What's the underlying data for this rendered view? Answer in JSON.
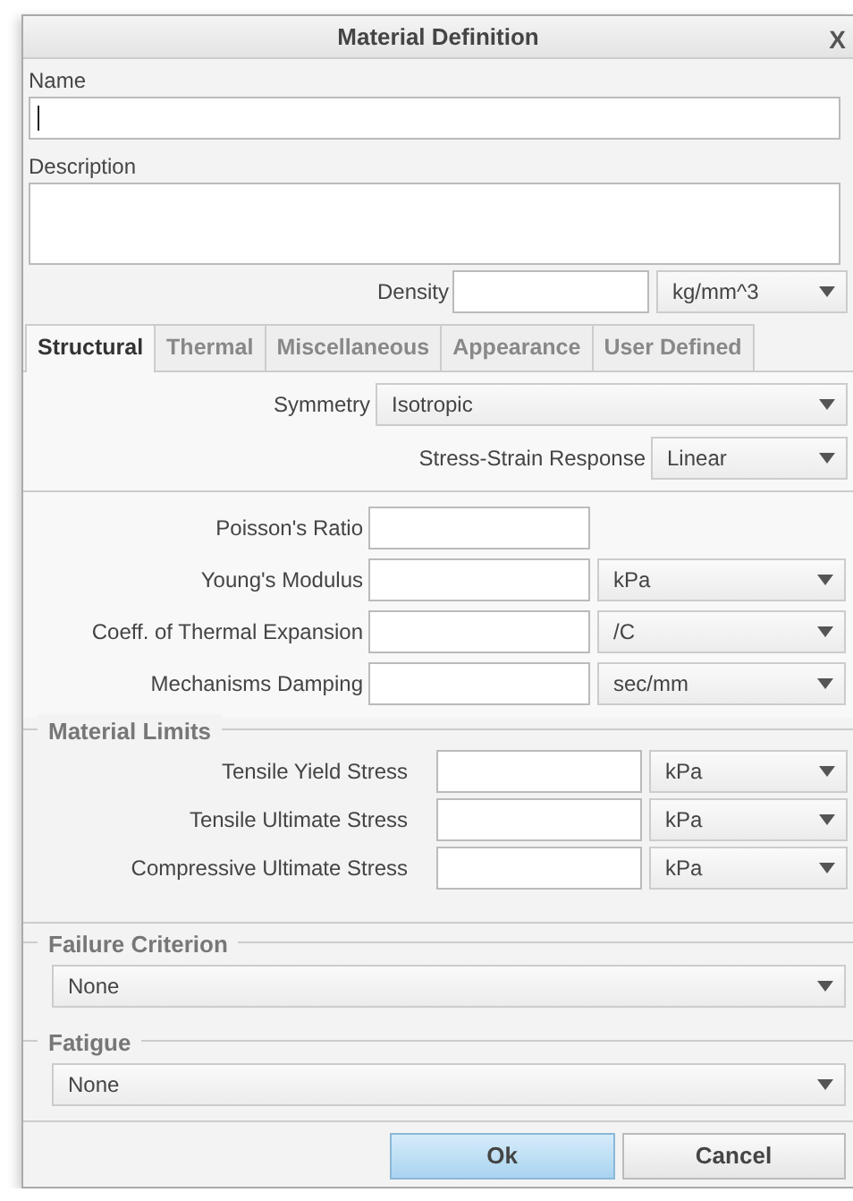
{
  "window": {
    "title": "Material Definition",
    "close": "X"
  },
  "name": {
    "label": "Name",
    "focused": true
  },
  "description": {
    "label": "Description"
  },
  "density": {
    "label": "Density",
    "unit": "kg/mm^3"
  },
  "tabs": [
    {
      "label": "Structural",
      "selected": true
    },
    {
      "label": "Thermal",
      "selected": false
    },
    {
      "label": "Miscellaneous",
      "selected": false
    },
    {
      "label": "Appearance",
      "selected": false
    },
    {
      "label": "User Defined",
      "selected": false
    }
  ],
  "symmetry": {
    "label": "Symmetry",
    "value": "Isotropic"
  },
  "stress_strain": {
    "label": "Stress-Strain Response",
    "value": "Linear"
  },
  "properties": [
    {
      "label": "Poisson's Ratio"
    },
    {
      "label": "Young's Modulus",
      "unit": "kPa"
    },
    {
      "label": "Coeff. of Thermal Expansion",
      "unit": "/C"
    },
    {
      "label": "Mechanisms Damping",
      "unit": "sec/mm"
    }
  ],
  "material_limits": {
    "title": "Material Limits",
    "rows": [
      {
        "label": "Tensile Yield Stress",
        "unit": "kPa"
      },
      {
        "label": "Tensile Ultimate Stress",
        "unit": "kPa"
      },
      {
        "label": "Compressive Ultimate Stress",
        "unit": "kPa"
      }
    ]
  },
  "failure_criterion": {
    "title": "Failure Criterion",
    "value": "None"
  },
  "fatigue": {
    "title": "Fatigue",
    "value": "None"
  },
  "buttons": [
    {
      "label": "Ok",
      "kind": "primary"
    },
    {
      "label": "Cancel",
      "kind": "secondary"
    }
  ]
}
